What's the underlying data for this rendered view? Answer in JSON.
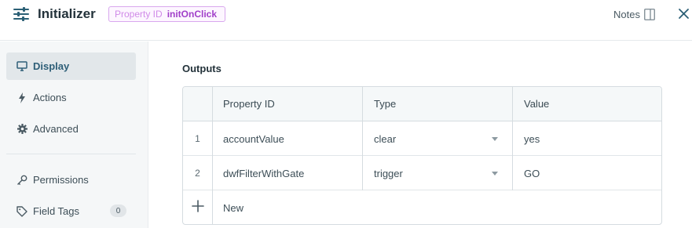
{
  "header": {
    "title": "Initializer",
    "badge_key": "Property ID",
    "badge_value": "initOnClick",
    "notes_label": "Notes"
  },
  "sidebar": {
    "items": [
      {
        "label": "Display",
        "icon": "monitor-icon",
        "active": true
      },
      {
        "label": "Actions",
        "icon": "bolt-icon",
        "active": false
      },
      {
        "label": "Advanced",
        "icon": "gear-icon",
        "active": false
      },
      {
        "label": "Permissions",
        "icon": "key-icon",
        "active": false
      },
      {
        "label": "Field Tags",
        "icon": "tag-icon",
        "active": false,
        "count": "0"
      }
    ]
  },
  "outputs": {
    "title": "Outputs",
    "columns": [
      "Property ID",
      "Type",
      "Value"
    ],
    "rows": [
      {
        "num": "1",
        "property_id": "accountValue",
        "type": "clear",
        "value": "yes"
      },
      {
        "num": "2",
        "property_id": "dwfFilterWithGate",
        "type": "trigger",
        "value": "GO"
      }
    ],
    "new_label": "New"
  },
  "colors": {
    "accent": "#2e5f78",
    "badge_text": "#a13fc9",
    "badge_border": "#d9a8ee"
  }
}
